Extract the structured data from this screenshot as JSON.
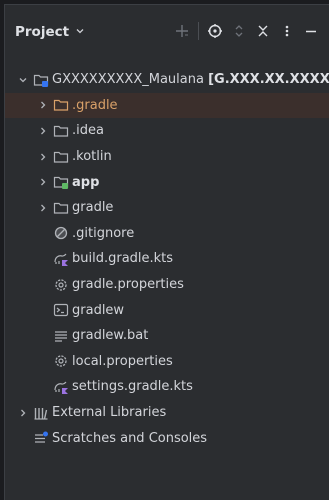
{
  "panel": {
    "title": "Project",
    "toolbar": [
      "add-icon",
      "target-icon",
      "expand-collapse-icon",
      "close-all-icon",
      "more-icon",
      "minimize-icon"
    ]
  },
  "tree": {
    "root": {
      "name": "GXXXXXXXXX_Maulana",
      "path": "[G.XXX.XX.XXXX_M"
    },
    "items": [
      {
        "label": ".gradle",
        "icon": "folder-orange-icon"
      },
      {
        "label": ".idea",
        "icon": "folder-icon"
      },
      {
        "label": ".kotlin",
        "icon": "folder-icon"
      },
      {
        "label": "app",
        "icon": "module-folder-icon"
      },
      {
        "label": "gradle",
        "icon": "folder-icon"
      },
      {
        "label": ".gitignore",
        "icon": "ignore-icon"
      },
      {
        "label": "build.gradle.kts",
        "icon": "gradle-kotlin-icon"
      },
      {
        "label": "gradle.properties",
        "icon": "gear-icon"
      },
      {
        "label": "gradlew",
        "icon": "terminal-icon"
      },
      {
        "label": "gradlew.bat",
        "icon": "text-lines-icon"
      },
      {
        "label": "local.properties",
        "icon": "gear-icon"
      },
      {
        "label": "settings.gradle.kts",
        "icon": "gradle-kotlin-icon"
      }
    ],
    "external_libraries": "External Libraries",
    "scratches": "Scratches and Consoles"
  },
  "colors": {
    "panel_bg": "#2b2d30",
    "selected_row": "#3b2f2c",
    "excluded_folder": "#d9a169",
    "module_badge": "#5fb865"
  }
}
